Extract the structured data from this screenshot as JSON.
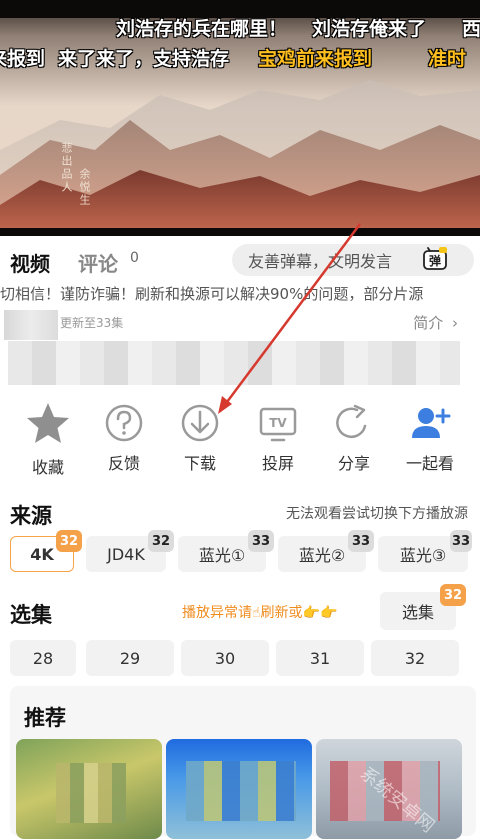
{
  "player": {
    "danmaku": [
      {
        "text": "刘浩存的兵在哪里！",
        "color": "white"
      },
      {
        "text": "刘浩存俺来了",
        "color": "white"
      },
      {
        "text": "西",
        "color": "white"
      },
      {
        "text": "来报到",
        "color": "white"
      },
      {
        "text": "来了来了，支持浩存",
        "color": "white"
      },
      {
        "text": "宝鸡前来报到",
        "color": "gold"
      },
      {
        "text": "准时",
        "color": "gold"
      }
    ],
    "seal_text": "悲出品人",
    "artist_text": "余悦生"
  },
  "tabs": {
    "video_label": "视频",
    "comment_label": "评论",
    "comment_count": "0",
    "danmaku_placeholder": "友善弹幕，文明发言",
    "danmaku_button_glyph": "弹"
  },
  "notice": "切相信！谨防诈骗！刷新和换源可以解决90%的问题，部分片源",
  "update": {
    "text": "更新至33集",
    "intro_label": "简介",
    "intro_chevron": "›"
  },
  "actions": [
    {
      "label": "收藏",
      "icon": "star-icon"
    },
    {
      "label": "反馈",
      "icon": "question-icon"
    },
    {
      "label": "下载",
      "icon": "download-icon"
    },
    {
      "label": "投屏",
      "icon": "tv-cast-icon"
    },
    {
      "label": "分享",
      "icon": "share-icon"
    },
    {
      "label": "一起看",
      "icon": "add-user-icon"
    }
  ],
  "sources": {
    "title": "来源",
    "hint": "无法观看尝试切换下方播放源",
    "items": [
      {
        "label": "4K",
        "badge": "32",
        "selected": true
      },
      {
        "label": "JD4K",
        "badge": "32",
        "selected": false
      },
      {
        "label": "蓝光①",
        "badge": "33",
        "selected": false
      },
      {
        "label": "蓝光②",
        "badge": "33",
        "selected": false
      },
      {
        "label": "蓝光③",
        "badge": "33",
        "selected": false
      }
    ]
  },
  "episodes": {
    "title": "选集",
    "hint": "播放异常请☝刷新或👉👉",
    "select_label": "选集",
    "select_badge": "32",
    "items": [
      "28",
      "29",
      "30",
      "31",
      "32"
    ]
  },
  "recommend": {
    "title": "推荐"
  },
  "watermark": "系统安卓网",
  "colors": {
    "accent_orange": "#f5a14a",
    "hint_orange": "#f08c1e",
    "icon_gray": "#9a9a9a",
    "icon_blue": "#3d7fe0",
    "annotation_red": "#d63a2f"
  }
}
